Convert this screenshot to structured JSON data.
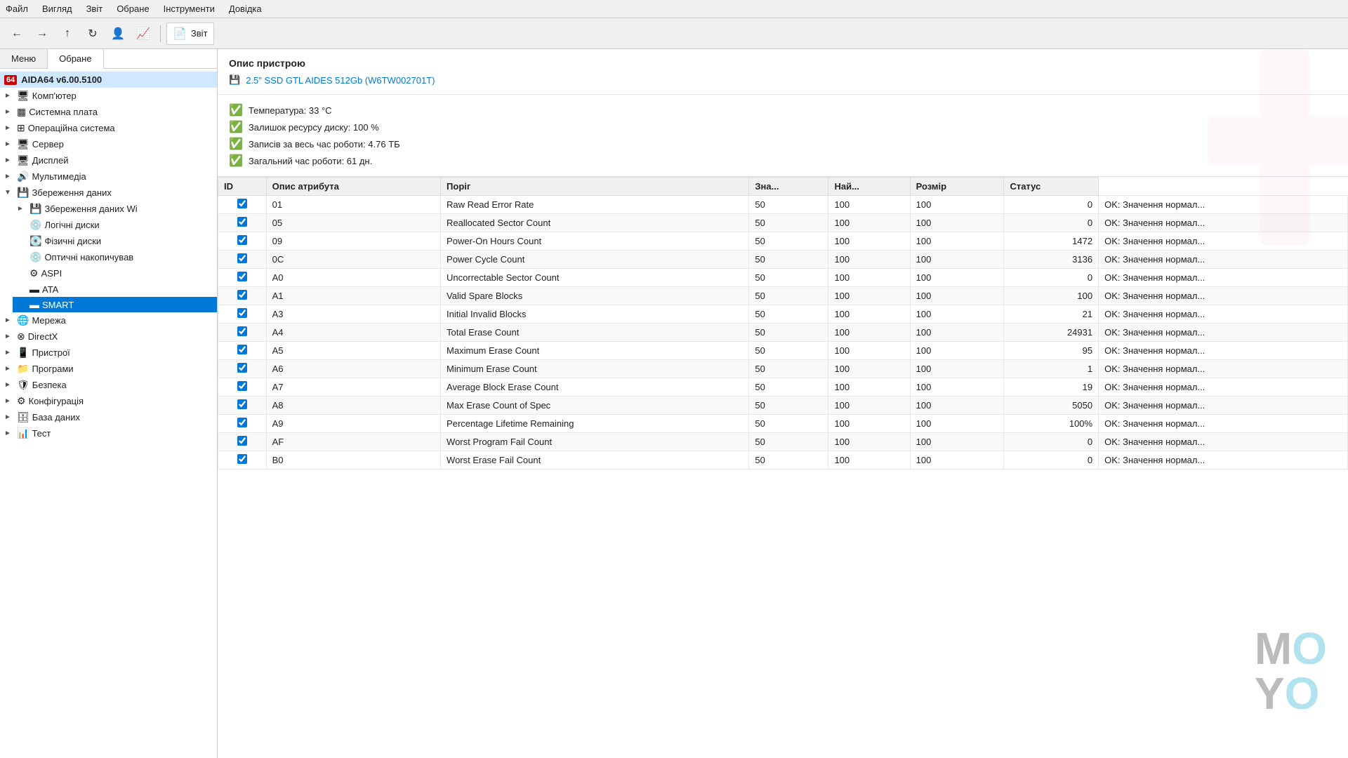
{
  "menubar": {
    "items": [
      "Файл",
      "Вигляд",
      "Звіт",
      "Обране",
      "Інструменти",
      "Довідка"
    ]
  },
  "toolbar": {
    "buttons": [
      "←",
      "→",
      "↑",
      "↻",
      "👤",
      "📈"
    ],
    "report_label": "Звіт"
  },
  "sidebar": {
    "tab_menu": "Меню",
    "tab_favorites": "Обране",
    "app_title": "AIDA64 v6.00.5100",
    "tree": [
      {
        "id": "computer",
        "label": "Комп'ютер",
        "icon": "🖥",
        "expanded": false
      },
      {
        "id": "motherboard",
        "label": "Системна плата",
        "icon": "▦",
        "expanded": false
      },
      {
        "id": "os",
        "label": "Операційна система",
        "icon": "⊞",
        "expanded": false
      },
      {
        "id": "server",
        "label": "Сервер",
        "icon": "🖥",
        "expanded": false
      },
      {
        "id": "display",
        "label": "Дисплей",
        "icon": "🖥",
        "expanded": false
      },
      {
        "id": "multimedia",
        "label": "Мультимедіа",
        "icon": "🔊",
        "expanded": false
      },
      {
        "id": "storage",
        "label": "Збереження даних",
        "icon": "💾",
        "expanded": true,
        "children": [
          {
            "id": "storage-wi",
            "label": "Збереження даних Wi",
            "icon": "💾"
          },
          {
            "id": "logical",
            "label": "Логічні диски",
            "icon": "💿"
          },
          {
            "id": "physical",
            "label": "Фізичні диски",
            "icon": "💽"
          },
          {
            "id": "optical",
            "label": "Оптичні накопичував",
            "icon": "💿"
          },
          {
            "id": "aspi",
            "label": "ASPI",
            "icon": "⚙"
          },
          {
            "id": "ata",
            "label": "ATA",
            "icon": "▬"
          },
          {
            "id": "smart",
            "label": "SMART",
            "icon": "▬",
            "selected": true
          }
        ]
      },
      {
        "id": "network",
        "label": "Мережа",
        "icon": "🌐",
        "expanded": false
      },
      {
        "id": "directx",
        "label": "DirectX",
        "icon": "⊗",
        "expanded": false
      },
      {
        "id": "devices",
        "label": "Пристрої",
        "icon": "📱",
        "expanded": false
      },
      {
        "id": "programs",
        "label": "Програми",
        "icon": "📁",
        "expanded": false
      },
      {
        "id": "security",
        "label": "Безпека",
        "icon": "🛡",
        "expanded": false
      },
      {
        "id": "config",
        "label": "Конфігурація",
        "icon": "⚙",
        "expanded": false
      },
      {
        "id": "database",
        "label": "База даних",
        "icon": "🗄",
        "expanded": false
      },
      {
        "id": "test",
        "label": "Тест",
        "icon": "📊",
        "expanded": false
      }
    ]
  },
  "content": {
    "device_title": "Опис пристрою",
    "device_name": "2.5\" SSD GTL AIDES 512Gb (W6TW002701T)",
    "status_items": [
      "Температура: 33 °C",
      "Залишок ресурсу диску: 100 %",
      "Записів за весь час роботи: 4.76 ТБ",
      "Загальний час роботи: 61 дн."
    ],
    "table": {
      "headers": [
        "ID",
        "Опис атрибута",
        "Поріг",
        "Зна...",
        "Най...",
        "Розмір",
        "Статус"
      ],
      "rows": [
        {
          "id": "01",
          "desc": "Raw Read Error Rate",
          "threshold": 50,
          "value": 100,
          "worst": 100,
          "raw": 0,
          "status": "OK: Значення нормал..."
        },
        {
          "id": "05",
          "desc": "Reallocated Sector Count",
          "threshold": 50,
          "value": 100,
          "worst": 100,
          "raw": 0,
          "status": "OK: Значення нормал..."
        },
        {
          "id": "09",
          "desc": "Power-On Hours Count",
          "threshold": 50,
          "value": 100,
          "worst": 100,
          "raw": 1472,
          "status": "OK: Значення нормал..."
        },
        {
          "id": "0C",
          "desc": "Power Cycle Count",
          "threshold": 50,
          "value": 100,
          "worst": 100,
          "raw": 3136,
          "status": "OK: Значення нормал..."
        },
        {
          "id": "A0",
          "desc": "Uncorrectable Sector Count",
          "threshold": 50,
          "value": 100,
          "worst": 100,
          "raw": 0,
          "status": "OK: Значення нормал..."
        },
        {
          "id": "A1",
          "desc": "Valid Spare Blocks",
          "threshold": 50,
          "value": 100,
          "worst": 100,
          "raw": 100,
          "status": "OK: Значення нормал..."
        },
        {
          "id": "A3",
          "desc": "Initial Invalid Blocks",
          "threshold": 50,
          "value": 100,
          "worst": 100,
          "raw": 21,
          "status": "OK: Значення нормал..."
        },
        {
          "id": "A4",
          "desc": "Total Erase Count",
          "threshold": 50,
          "value": 100,
          "worst": 100,
          "raw": 24931,
          "status": "OK: Значення нормал..."
        },
        {
          "id": "A5",
          "desc": "Maximum Erase Count",
          "threshold": 50,
          "value": 100,
          "worst": 100,
          "raw": 95,
          "status": "OK: Значення нормал..."
        },
        {
          "id": "A6",
          "desc": "Minimum Erase Count",
          "threshold": 50,
          "value": 100,
          "worst": 100,
          "raw": 1,
          "status": "OK: Значення нормал..."
        },
        {
          "id": "A7",
          "desc": "Average Block Erase Count",
          "threshold": 50,
          "value": 100,
          "worst": 100,
          "raw": 19,
          "status": "OK: Значення нормал..."
        },
        {
          "id": "A8",
          "desc": "Max Erase Count of Spec",
          "threshold": 50,
          "value": 100,
          "worst": 100,
          "raw": 5050,
          "status": "OK: Значення нормал..."
        },
        {
          "id": "A9",
          "desc": "Percentage Lifetime Remaining",
          "threshold": 50,
          "value": 100,
          "worst": 100,
          "raw": "100%",
          "status": "OK: Значення нормал..."
        },
        {
          "id": "AF",
          "desc": "Worst Program Fail Count",
          "threshold": 50,
          "value": 100,
          "worst": 100,
          "raw": 0,
          "status": "OK: Значення нормал..."
        },
        {
          "id": "B0",
          "desc": "Worst Erase Fail Count",
          "threshold": 50,
          "value": 100,
          "worst": 100,
          "raw": 0,
          "status": "OK: Значення нормал..."
        }
      ]
    }
  }
}
